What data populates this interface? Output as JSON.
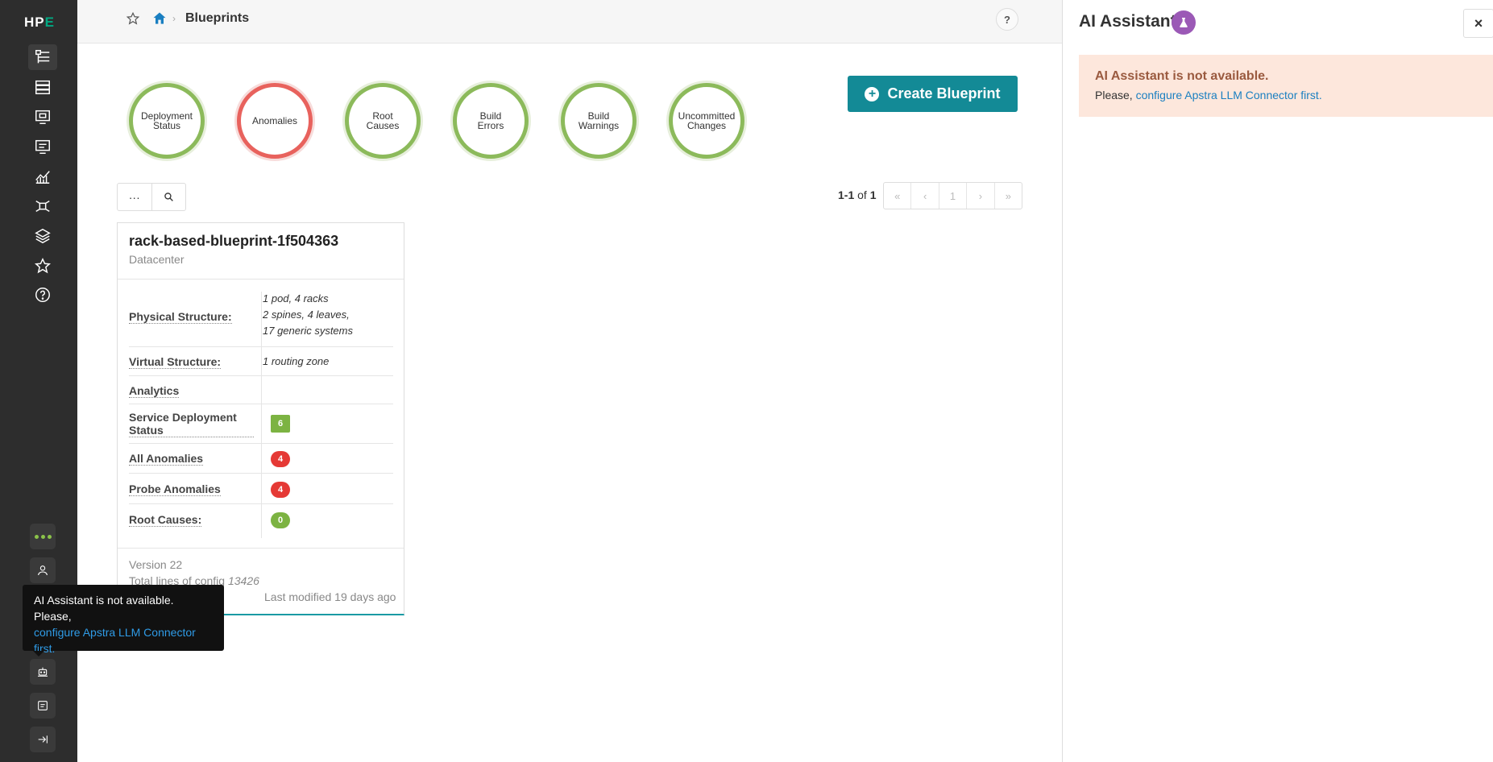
{
  "sidebar": {
    "logo_prefix": "HP",
    "logo_suffix": "E",
    "icons": [
      "blueprints-icon",
      "devices-icon",
      "design-icon",
      "resources-icon",
      "analytics-icon",
      "external-systems-icon",
      "platform-icon",
      "favorites-icon",
      "help-icon"
    ],
    "bottom": [
      "more-dots-icon",
      "user-icon",
      "ai-assistant-icon",
      "log-icon",
      "collapse-icon"
    ]
  },
  "breadcrumb": {
    "title": "Blueprints",
    "help_label": "?"
  },
  "status_circles": [
    {
      "line1": "Deployment",
      "line2": "Status",
      "state": "ok"
    },
    {
      "line1": "Anomalies",
      "line2": "",
      "state": "error"
    },
    {
      "line1": "Root",
      "line2": "Causes",
      "state": "ok"
    },
    {
      "line1": "Build",
      "line2": "Errors",
      "state": "ok"
    },
    {
      "line1": "Build",
      "line2": "Warnings",
      "state": "ok"
    },
    {
      "line1": "Uncommitted",
      "line2": "Changes",
      "state": "ok"
    }
  ],
  "create_button": {
    "label": "Create Blueprint"
  },
  "toolbar": {
    "more_label": "···"
  },
  "pagination": {
    "range": "1-1",
    "of_label": "of",
    "total": "1",
    "first": "«",
    "prev": "‹",
    "page": "1",
    "next": "›",
    "last": "»"
  },
  "blueprint": {
    "name": "rack-based-blueprint-1f504363",
    "type": "Datacenter",
    "physical_label": "Physical Structure:",
    "physical_line1": "1 pod, 4 racks",
    "physical_line2": "2 spines, 4 leaves,",
    "physical_line3": "17 generic systems",
    "virtual_label": "Virtual Structure:",
    "virtual_value": "1 routing zone",
    "analytics_label": "Analytics",
    "service_label_1": "Service Deployment",
    "service_label_2": "Status",
    "service_value": "6",
    "anomalies_label": "All Anomalies",
    "anomalies_value": "4",
    "probe_label": "Probe Anomalies",
    "probe_value": "4",
    "root_label": "Root Causes:",
    "root_value": "0",
    "version": "Version 22",
    "config_label": "Total lines of config",
    "config_value": "13426",
    "modified": "Last modified 19 days ago"
  },
  "tooltip": {
    "text": "AI Assistant is not available. Please,",
    "link": "configure Apstra LLM Connector first."
  },
  "ai_panel": {
    "title": "AI Assistant",
    "close_label": "×",
    "alert_heading": "AI Assistant is not available.",
    "alert_prefix": "Please,",
    "alert_link": "configure Apstra LLM Connector first."
  },
  "colors": {
    "ok": "#8cba5b",
    "error": "#e8625d",
    "primary": "#138a96",
    "badge_green": "#7cb342",
    "badge_red": "#e53935",
    "ai_purple": "#9b59b6"
  }
}
